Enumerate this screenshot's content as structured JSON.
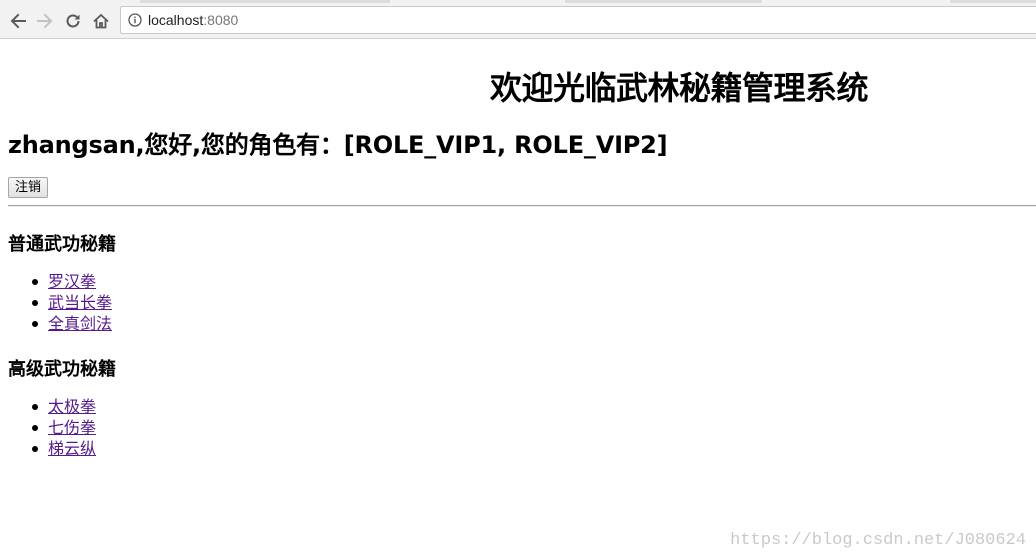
{
  "browser": {
    "url_host": "localhost",
    "url_port": ":8080",
    "icons": {
      "back": "back-arrow-icon",
      "forward": "forward-arrow-icon",
      "reload": "reload-icon",
      "home": "home-icon",
      "info": "info-icon"
    }
  },
  "page": {
    "title": "欢迎光临武林秘籍管理系统",
    "greeting": "zhangsan,您好,您的角色有：[ROLE_VIP1, ROLE_VIP2]",
    "logout_label": "注销",
    "sections": [
      {
        "title": "普通武功秘籍",
        "items": [
          "罗汉拳",
          "武当长拳",
          "全真剑法"
        ]
      },
      {
        "title": "高级武功秘籍",
        "items": [
          "太极拳",
          "七伤拳",
          "梯云纵"
        ]
      }
    ],
    "link_color": "#551a8b"
  },
  "watermark": "https://blog.csdn.net/J080624"
}
